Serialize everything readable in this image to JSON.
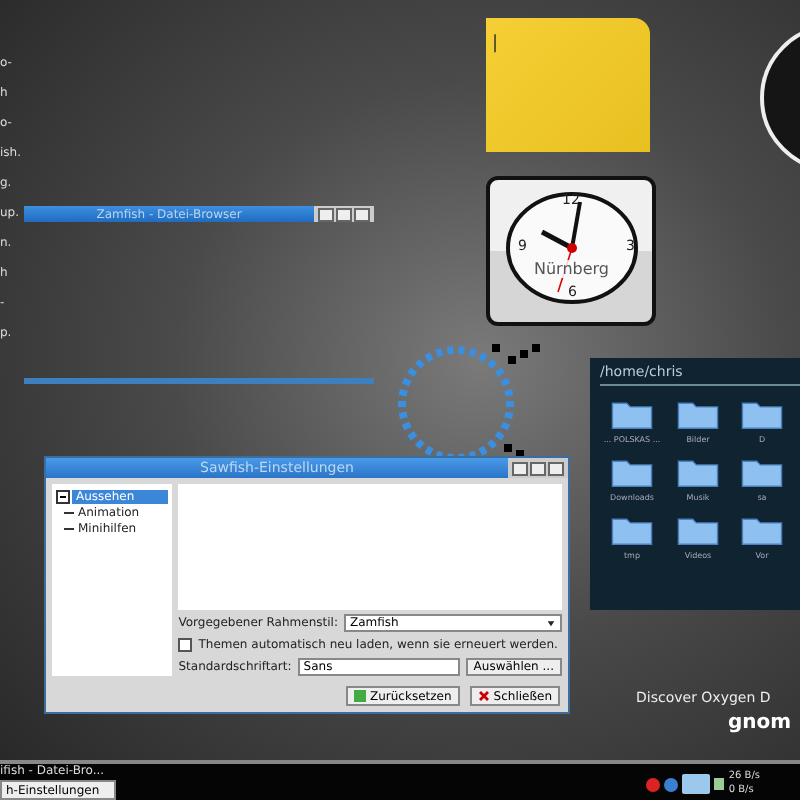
{
  "left_edge_texts": [
    "o-",
    "h",
    "o-",
    "ish.",
    "g.",
    "up.",
    "n.",
    "h",
    "-",
    "p."
  ],
  "mini_window": {
    "title": "Zamfish - Datei-Browser"
  },
  "sticky_note": {
    "text": "|"
  },
  "clock": {
    "numerals": [
      "12",
      "3",
      "6",
      "9"
    ],
    "city": "Nürnberg"
  },
  "folder_view": {
    "path": "/home/chris",
    "items": [
      {
        "label": "... POLSKAS ..."
      },
      {
        "label": "Bilder"
      },
      {
        "label": "D"
      },
      {
        "label": "Downloads"
      },
      {
        "label": "Musik"
      },
      {
        "label": "sa"
      },
      {
        "label": "tmp"
      },
      {
        "label": "Videos"
      },
      {
        "label": "Vor"
      }
    ]
  },
  "dialog": {
    "title": "Sawfish-Einstellungen",
    "tree": [
      {
        "label": "Aussehen",
        "selected": true,
        "expanded": true,
        "children": [
          {
            "label": "Animation",
            "selected": false
          },
          {
            "label": "Minihilfen",
            "selected": false
          }
        ]
      }
    ],
    "frame_style": {
      "label": "Vorgegebener Rahmenstil:",
      "value": "Zamfish"
    },
    "auto_reload": {
      "label": "Themen automatisch neu laden, wenn sie erneuert werden.",
      "checked": false
    },
    "font": {
      "label": "Standardschriftart:",
      "value": "Sans",
      "button": "Auswählen ..."
    },
    "buttons": [
      "Zurücksetzen",
      "Schließen"
    ]
  },
  "wallpaper_texts": [
    "Discover Oxygen D",
    "gnom"
  ],
  "taskbar": {
    "tooltip": "ifish - Datei-Bro...",
    "task": "h-Einstellungen",
    "net_up": "26 B/s",
    "net_down": "0 B/s"
  }
}
